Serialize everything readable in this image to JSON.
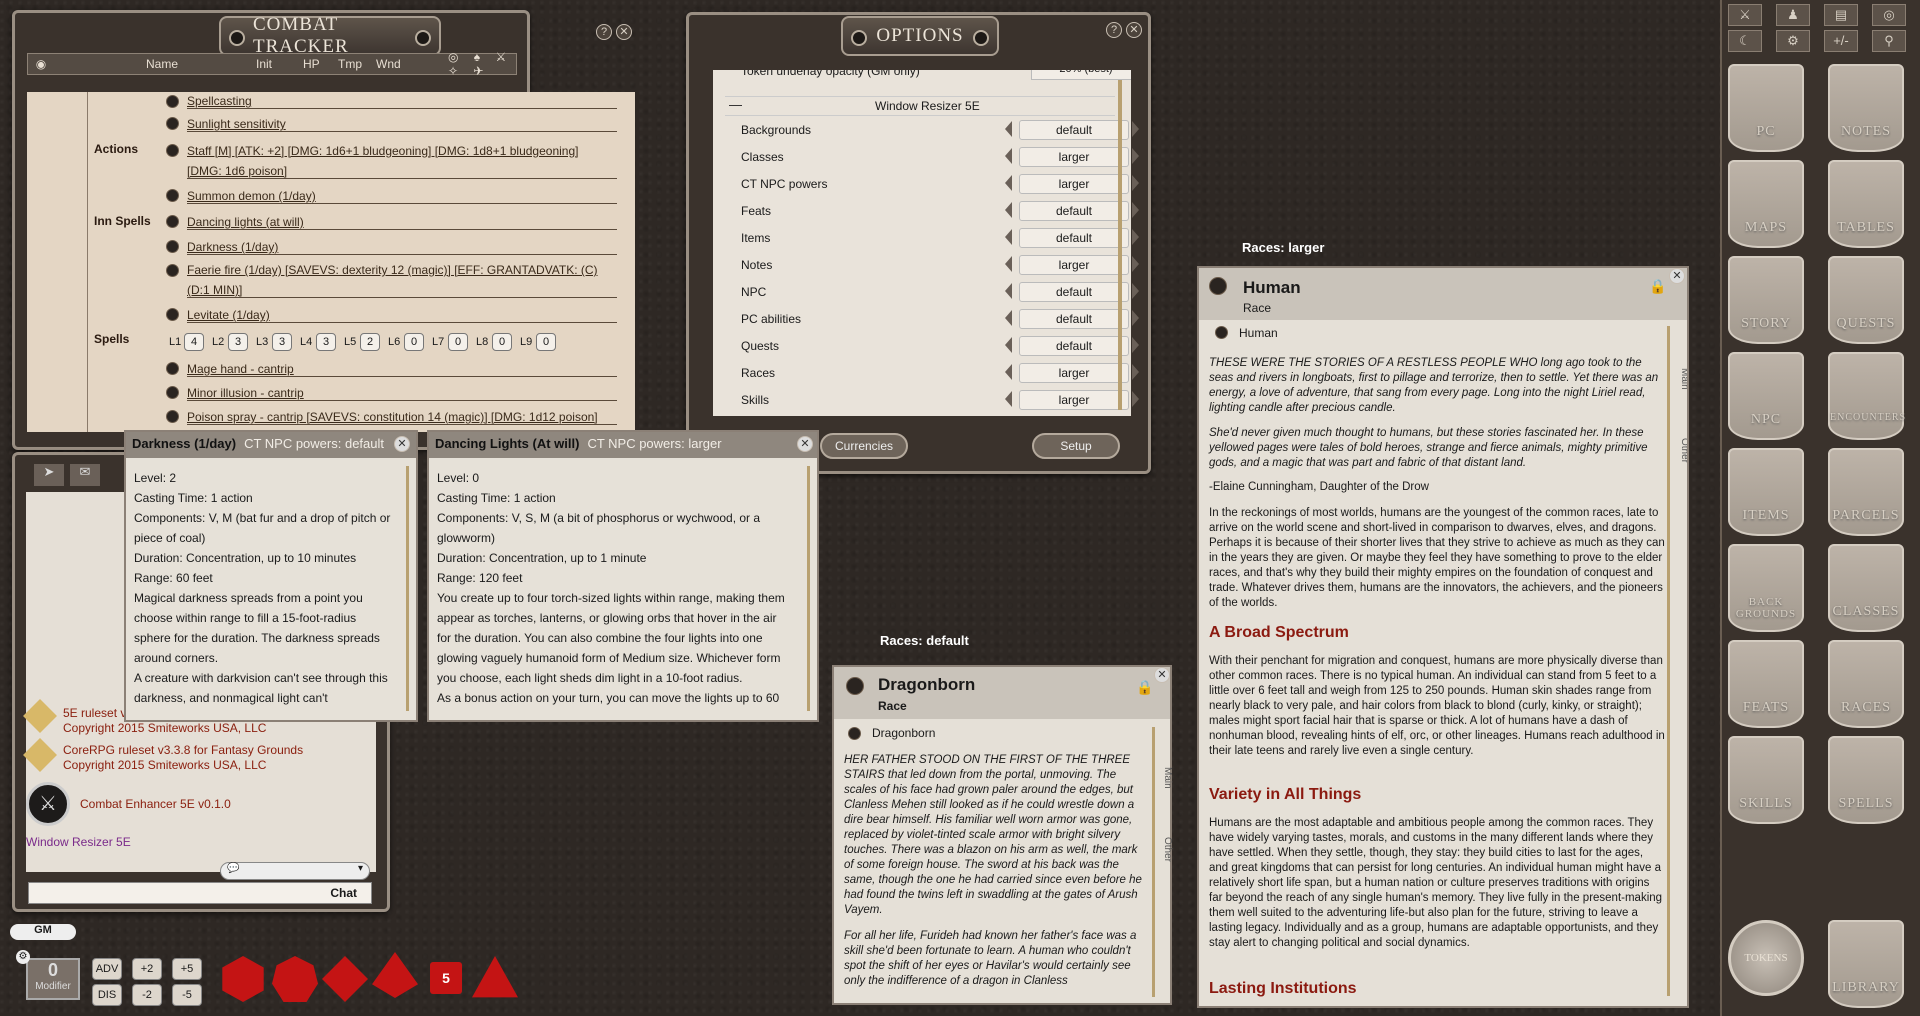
{
  "combat_tracker": {
    "title": "COMBAT TRACKER",
    "columns": [
      "Name",
      "Init",
      "HP",
      "Tmp",
      "Wnd"
    ],
    "labels": {
      "actions": "Actions",
      "inn_spells": "Inn Spells",
      "spells": "Spells"
    },
    "rows": [
      "Spellcasting",
      "Sunlight sensitivity",
      "Staff [M] [ATK: +2] [DMG: 1d6+1 bludgeoning] [DMG: 1d8+1 bludgeoning]",
      "[DMG: 1d6 poison]",
      "Summon demon (1/day)",
      "Dancing lights (at will)",
      "Darkness (1/day)",
      "Faerie fire (1/day) [SAVEVS: dexterity 12 (magic)] [EFF: GRANTADVATK: (C)",
      "(D:1 MIN)]",
      "Levitate (1/day)",
      "Mage hand - cantrip",
      "Minor illusion - cantrip",
      "Poison spray - cantrip [SAVEVS: constitution 14 (magic)] [DMG: 1d12 poison]"
    ],
    "slots": [
      {
        "label": "L1",
        "value": "4"
      },
      {
        "label": "L2",
        "value": "3"
      },
      {
        "label": "L3",
        "value": "3"
      },
      {
        "label": "L4",
        "value": "3"
      },
      {
        "label": "L5",
        "value": "2"
      },
      {
        "label": "L6",
        "value": "0"
      },
      {
        "label": "L7",
        "value": "0"
      },
      {
        "label": "L8",
        "value": "0"
      },
      {
        "label": "L9",
        "value": "0"
      }
    ]
  },
  "options": {
    "title": "OPTIONS",
    "top_partial": "Token underlay opacity (GM only)",
    "top_partial_value": "20% (best)",
    "section": "Window Resizer 5E",
    "rows": [
      {
        "label": "Backgrounds",
        "value": "default"
      },
      {
        "label": "Classes",
        "value": "larger"
      },
      {
        "label": "CT NPC powers",
        "value": "larger"
      },
      {
        "label": "Feats",
        "value": "default"
      },
      {
        "label": "Items",
        "value": "default"
      },
      {
        "label": "Notes",
        "value": "larger"
      },
      {
        "label": "NPC",
        "value": "default"
      },
      {
        "label": "PC abilities",
        "value": "default"
      },
      {
        "label": "Quests",
        "value": "default"
      },
      {
        "label": "Races",
        "value": "larger"
      },
      {
        "label": "Skills",
        "value": "larger"
      }
    ],
    "currencies_btn": "Currencies",
    "setup_btn": "Setup"
  },
  "popup_darkness": {
    "title": "Darkness (1/day)",
    "subtitle": "CT NPC powers: default",
    "lines": [
      "Level: 2",
      "Casting Time: 1 action",
      "Components: V, M (bat fur and a drop of pitch or piece of coal)",
      "Duration: Concentration, up to 10 minutes",
      "Range: 60 feet",
      "Magical darkness spreads from a point you choose within range to fill a 15-foot-radius sphere for the duration. The darkness spreads around corners.",
      "A creature with darkvision can't see through this darkness, and nonmagical light can't"
    ]
  },
  "popup_lights": {
    "title": "Dancing Lights (At will)",
    "subtitle": "CT NPC powers: larger",
    "lines": [
      "Level: 0",
      "Casting Time: 1 action",
      "Components: V, S, M (a bit of phosphorus or wychwood, or a glowworm)",
      "Duration: Concentration, up to 1 minute",
      "Range: 120 feet",
      "You create up to four torch-sized lights within range, making them appear as torches, lanterns, or glowing orbs that hover in the air for the duration. You can also combine the four lights into one glowing vaguely humanoid form of Medium size. Whichever form you choose, each light sheds dim light in a 10-foot radius.",
      "As a bonus action on your turn, you can move the lights up to 60"
    ]
  },
  "chat": {
    "rulesets": [
      {
        "name": "5E ruleset v",
        "copy": "Copyright 2015 Smiteworks USA, LLC"
      },
      {
        "name": "CoreRPG ruleset v3.3.8 for Fantasy Grounds",
        "copy": "Copyright 2015 Smiteworks USA, LLC"
      }
    ],
    "extension": "Combat Enhancer 5E v0.1.0",
    "extension2": "Window Resizer 5E",
    "chat_btn": "Chat",
    "gm": "GM",
    "modifier_value": "0",
    "modifier_label": "Modifier",
    "mods": [
      "ADV",
      "+2",
      "+5",
      "DIS",
      "-2",
      "-5"
    ],
    "dice": [
      "d20",
      "d12",
      "d10",
      "d8",
      "d6",
      "d4"
    ],
    "die_label_d6": "5"
  },
  "dragonborn": {
    "caption": "Races: default",
    "title": "Dragonborn",
    "type": "Race",
    "link": "Dragonborn",
    "tabs": [
      "Main",
      "Other"
    ],
    "p1": "HER FATHER STOOD ON THE FIRST OF THE THREE STAIRS that led down from the portal, unmoving. The scales of his face had grown paler around the edges, but Clanless Mehen still looked as if he could wrestle down a dire bear himself. His familiar well worn armor was gone, replaced by violet-tinted scale armor with bright silvery touches. There was a blazon on his arm as well, the mark of some foreign house. The sword at his back was the same, though the one he had carried since even before he had found the twins left in swaddling at the gates of Arush Vayem.",
    "p2": "For all her life, Furideh had known her father's face was a skill she'd been fortunate to learn. A human who couldn't spot the shift of her eyes or Havilar's would certainly see only the indifference of a dragon in Clanless"
  },
  "human": {
    "caption": "Races: larger",
    "title": "Human",
    "type": "Race",
    "link": "Human",
    "tabs": [
      "Main",
      "Other"
    ],
    "p1": "THESE WERE THE STORIES OF A RESTLESS PEOPLE WHO long ago took to the seas and rivers in longboats, first to pillage and terrorize, then to settle. Yet there was an energy, a love of adventure, that sang from every page. Long into the night Liriel read, lighting candle after precious candle.",
    "p2": "She'd never given much thought to humans, but these stories fascinated her. In these yellowed pages were tales of bold heroes, strange and fierce animals, mighty primitive gods, and a magic that was part and fabric of that distant land.",
    "p3": "-Elaine Cunningham, Daughter of the Drow",
    "p4": "In the reckonings of most worlds, humans are the youngest of the common races, late to arrive on the world scene and short-lived in comparison to dwarves, elves, and dragons. Perhaps it is because of their shorter lives that they strive to achieve as much as they can in the years they are given. Or maybe they feel they have something to prove to the elder races, and that's why they build their mighty empires on the foundation of conquest and trade. Whatever drives them, humans are the innovators, the achievers, and the pioneers of the worlds.",
    "h1": "A Broad Spectrum",
    "p5": "With their penchant for migration and conquest, humans are more physically diverse than other common races. There is no typical human. An individual can stand from 5 feet to a little over 6 feet tall and weigh from 125 to 250 pounds. Human skin shades range from nearly black to very pale, and hair colors from black to blond (curly, kinky, or straight); males might sport facial hair that is sparse or thick. A lot of humans have a dash of nonhuman blood, revealing hints of elf, orc, or other lineages. Humans reach adulthood in their late teens and rarely live even a single century.",
    "h2": "Variety in All Things",
    "p6": "Humans are the most adaptable and ambitious people among the common races. They have widely varying tastes, morals, and customs in the many different lands where they have settled. When they settle, though, they stay: they build cities to last for the ages, and great kingdoms that can persist for long centuries. An individual human might have a relatively short life span, but a human nation or culture preserves traditions with origins far beyond the reach of any single human's memory. They live fully in the present-making them well suited to the adventuring life-but also plan for the future, striving to leave a lasting legacy. Individually and as a group, humans are adaptable opportunists, and they stay alert to changing political and social dynamics.",
    "h3": "Lasting Institutions"
  },
  "sidebar": {
    "buttons": [
      "PC",
      "NOTES",
      "MAPS",
      "TABLES",
      "STORY",
      "QUESTS",
      "NPC",
      "ENCOUNTERS",
      "ITEMS",
      "PARCELS",
      "BACK GROUNDS",
      "CLASSES",
      "FEATS",
      "RACES",
      "SKILLS",
      "SPELLS",
      "TOKENS",
      "LIBRARY"
    ],
    "top_icons": [
      "⚔",
      "♟",
      "▤",
      "◎",
      "☾",
      "⚙",
      "+/-",
      "⚲"
    ]
  }
}
